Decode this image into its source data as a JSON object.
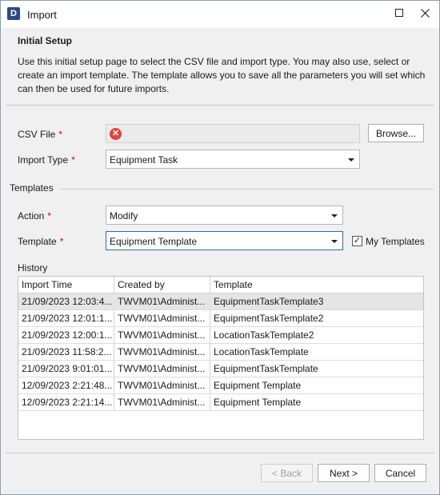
{
  "window": {
    "title": "Import",
    "app_icon_letter": "D"
  },
  "header": {
    "title": "Initial Setup",
    "description": "Use this initial setup page to select the CSV file and import type. You may also use, select or create an import template. The template allows you to save all the parameters you will set which can then be used for future imports."
  },
  "form": {
    "csv_label": "CSV File",
    "required_mark": "*",
    "browse_label": "Browse...",
    "import_type_label": "Import Type",
    "import_type_value": "Equipment Task"
  },
  "templates": {
    "section_label": "Templates",
    "action_label": "Action",
    "action_value": "Modify",
    "template_label": "Template",
    "template_value": "Equipment Template",
    "my_templates_label": "My Templates",
    "my_templates_checked": "✓"
  },
  "history": {
    "label": "History",
    "columns": [
      "Import Time",
      "Created by",
      "Template"
    ],
    "rows": [
      [
        "21/09/2023 12:03:4...",
        "TWVM01\\Administ...",
        "EquipmentTaskTemplate3"
      ],
      [
        "21/09/2023 12:01:1...",
        "TWVM01\\Administ...",
        "EquipmentTaskTemplate2"
      ],
      [
        "21/09/2023 12:00:1...",
        "TWVM01\\Administ...",
        "LocationTaskTemplate2"
      ],
      [
        "21/09/2023 11:58:2...",
        "TWVM01\\Administ...",
        "LocationTaskTemplate"
      ],
      [
        "21/09/2023 9:01:01...",
        "TWVM01\\Administ...",
        "EquipmentTaskTemplate"
      ],
      [
        "12/09/2023 2:21:48...",
        "TWVM01\\Administ...",
        "Equipment Template"
      ],
      [
        "12/09/2023 2:21:14...",
        "TWVM01\\Administ...",
        "Equipment Template"
      ]
    ]
  },
  "footer": {
    "back_label": "< Back",
    "next_label": "Next >",
    "cancel_label": "Cancel"
  },
  "icons": {
    "error": "error-icon",
    "close": "close-icon",
    "maximize": "maximize-icon",
    "dropdown": "chevron-down-icon"
  },
  "colors": {
    "accent": "#2d6da3",
    "required": "#d0021b",
    "error": "#e0443a",
    "app_icon": "#2b4a8c"
  }
}
